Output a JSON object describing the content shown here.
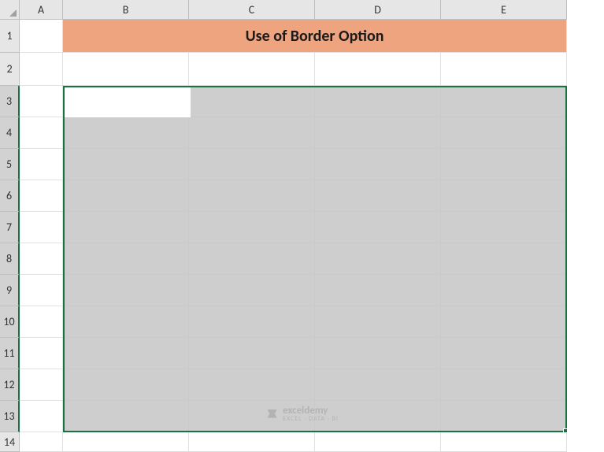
{
  "columns": [
    "A",
    "B",
    "C",
    "D",
    "E"
  ],
  "rows": [
    "1",
    "2",
    "3",
    "4",
    "5",
    "6",
    "7",
    "8",
    "9",
    "10",
    "11",
    "12",
    "13",
    "14"
  ],
  "title_cell": "Use of Border Option",
  "selection": {
    "range": "B3:E13",
    "active": "B3"
  },
  "watermark": {
    "main": "exceldemy",
    "sub": "EXCEL · DATA · BI"
  }
}
